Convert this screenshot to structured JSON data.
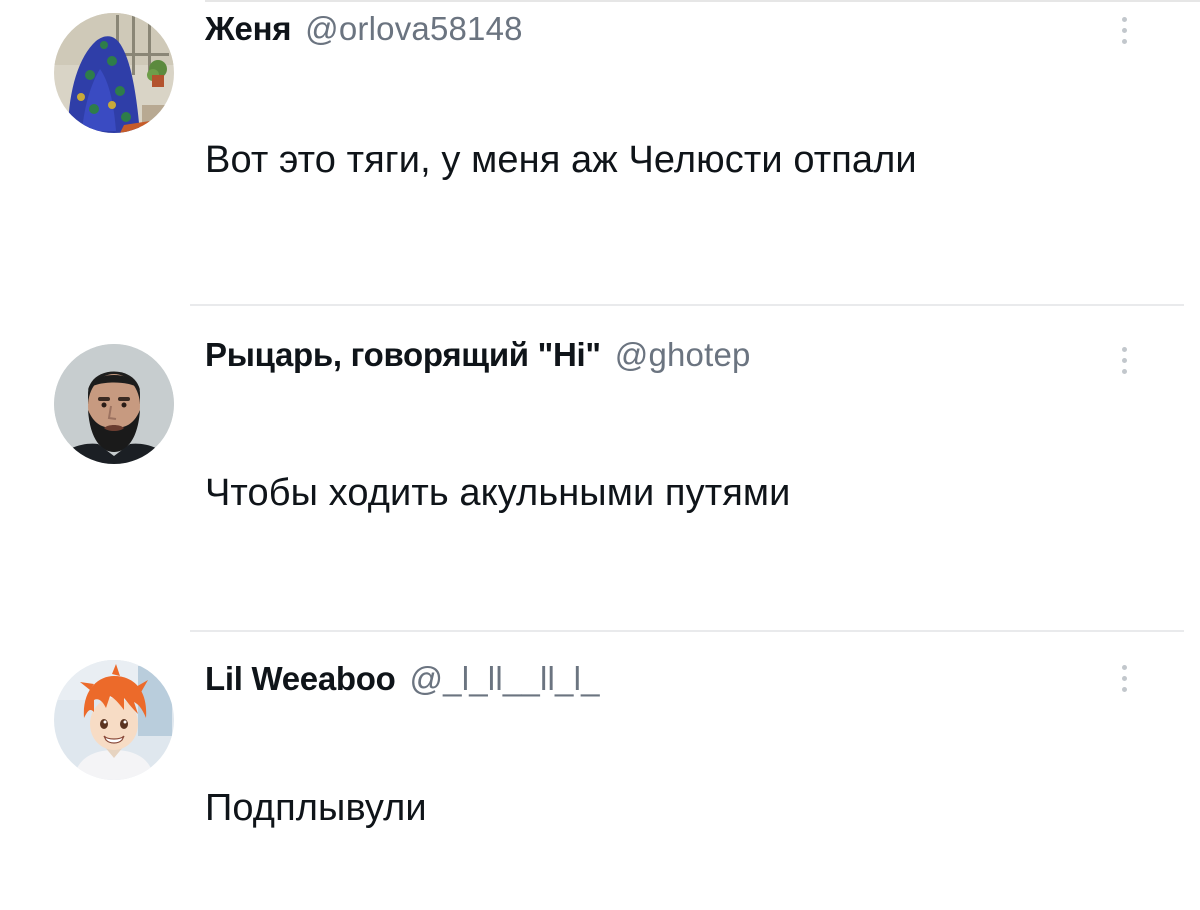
{
  "tweets": [
    {
      "author_name": "Женя",
      "author_handle": "@orlova58148",
      "text": "Вот это тяги, у меня аж Челюсти отпали",
      "avatar_icon": "avatar-blue-blanket-figure"
    },
    {
      "author_name": "Рыцарь, говорящий \"Hi\"",
      "author_handle": "@ghotep",
      "text": "Чтобы ходить акульными путями",
      "avatar_icon": "avatar-bearded-man"
    },
    {
      "author_name": "Lil Weeaboo",
      "author_handle": "@_l_ll__ll_l_",
      "text": "Подплывули",
      "avatar_icon": "avatar-orange-hair-anime"
    }
  ],
  "colors": {
    "text_primary": "#0f1419",
    "text_secondary": "#6b7480",
    "divider": "#e9eaec",
    "more_icon": "#c2c7cc"
  }
}
